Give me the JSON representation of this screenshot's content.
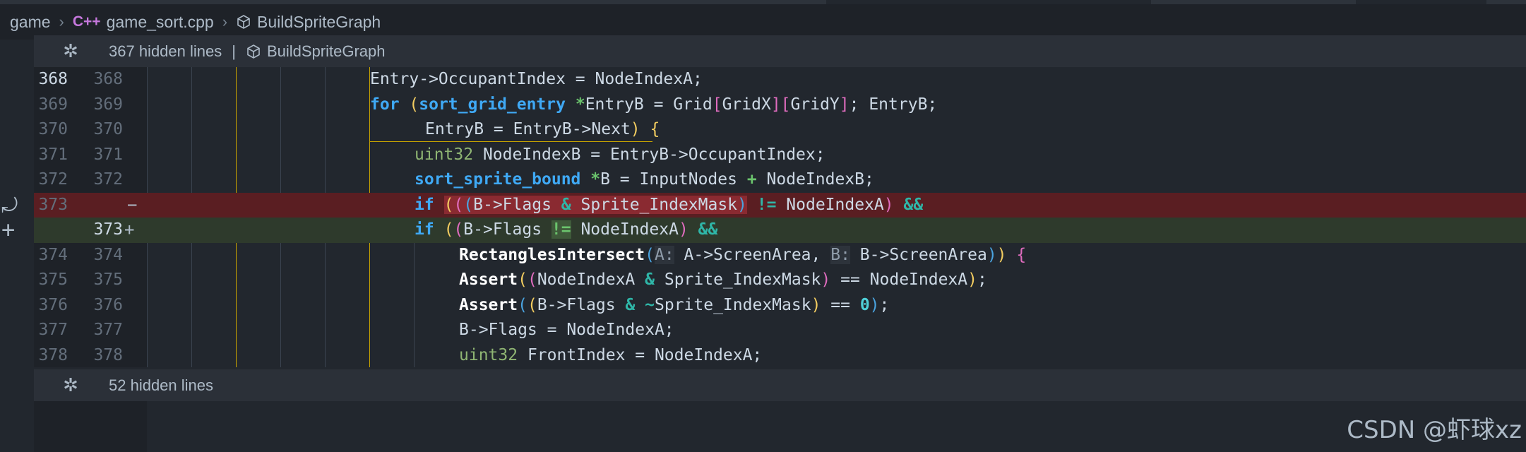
{
  "breadcrumb": {
    "folder": "game",
    "cpp_glyph": "C++",
    "file": "game_sort.cpp",
    "symbol": "BuildSpriteGraph"
  },
  "hidden_top": {
    "label": "367 hidden lines",
    "symbol": "BuildSpriteGraph"
  },
  "hidden_bottom": {
    "label": "52 hidden lines"
  },
  "lines": {
    "l368": {
      "old": "368",
      "new": "368"
    },
    "l369": {
      "old": "369",
      "new": "369"
    },
    "l370": {
      "old": "370",
      "new": "370"
    },
    "l371": {
      "old": "371",
      "new": "371"
    },
    "l372": {
      "old": "372",
      "new": "372"
    },
    "l373d": {
      "old": "373",
      "marker": "−"
    },
    "l373a": {
      "new": "373",
      "marker": "+"
    },
    "l374": {
      "old": "374",
      "new": "374"
    },
    "l375": {
      "old": "375",
      "new": "375"
    },
    "l376": {
      "old": "376",
      "new": "376"
    },
    "l377": {
      "old": "377",
      "new": "377"
    },
    "l378": {
      "old": "378",
      "new": "378"
    }
  },
  "code": {
    "l368": {
      "a": "Entry->OccupantIndex = NodeIndexA;"
    },
    "l369": {
      "kw": "for",
      "sp": " ",
      "lp": "(",
      "type": "sort_grid_entry",
      "star": " *",
      "rest1": "EntryB = Grid",
      "b1": "[",
      "gx": "GridX",
      "b2": "]",
      "b3": "[",
      "gy": "GridY",
      "b4": "]",
      "rest2": "; EntryB;"
    },
    "l370": {
      "a": "EntryB = EntryB->Next",
      "rp": ")",
      "br": " {"
    },
    "l371": {
      "type": "uint32",
      "a": " NodeIndexB = EntryB->OccupantIndex;"
    },
    "l372": {
      "type": "sort_sprite_bound",
      "star": " *",
      "a": "B = InputNodes ",
      "plus": "+",
      "b": " NodeIndexB;"
    },
    "l373d": {
      "kw": "if",
      "sp": " ",
      "p1": "(",
      "p2": "(",
      "p3": "(",
      "a": "B->Flags ",
      "amp": "&",
      "b": " Sprite_IndexMask",
      "rp1": ")",
      "ne": " !=",
      "c": " NodeIndexA",
      "rp2": ")",
      "and": " &&"
    },
    "l373a": {
      "kw": "if",
      "sp": " ",
      "p1": "(",
      "p2": "(",
      "a": "B->Flags ",
      "ne": "!=",
      "c": " NodeIndexA",
      "rp": ")",
      "and": " &&"
    },
    "l374": {
      "fn": "RectanglesIntersect",
      "lp": "(",
      "h1": "A:",
      "a1": " A->ScreenArea, ",
      "h2": "B:",
      "a2": " B->ScreenArea",
      "rp1": ")",
      "rp2": ")",
      "br": " {"
    },
    "l375": {
      "fn": "Assert",
      "lp": "(",
      "lp2": "(",
      "a": "NodeIndexA ",
      "amp": "&",
      "b": " Sprite_IndexMask",
      "rp2": ")",
      "c": " == NodeIndexA",
      "rp": ")",
      "end": ";"
    },
    "l376": {
      "fn": "Assert",
      "lp": "(",
      "lp2": "(",
      "a": "B->Flags ",
      "amp": "&",
      "tilde": " ~",
      "b": "Sprite_IndexMask",
      "rp2": ")",
      "c": " == ",
      "zero": "0",
      "rp": ")",
      "end": ";"
    },
    "l377": {
      "a": "B->Flags = NodeIndexA;"
    },
    "l378": {
      "type": "uint32",
      "a": " FrontIndex = NodeIndexA;"
    }
  },
  "watermark": "CSDN @虾球xz",
  "colors": {
    "keyword": "#3fa9f5",
    "type": "#8fb573",
    "deleted_row": "#5a1e22",
    "added_row": "#2e3a2c",
    "bracket_yellow": "#f2cc60",
    "bracket_pink": "#e06cbf"
  },
  "icons": [
    "cpp-file-icon",
    "cube-symbol-icon",
    "unfold-icon",
    "revert-icon",
    "add-icon"
  ]
}
